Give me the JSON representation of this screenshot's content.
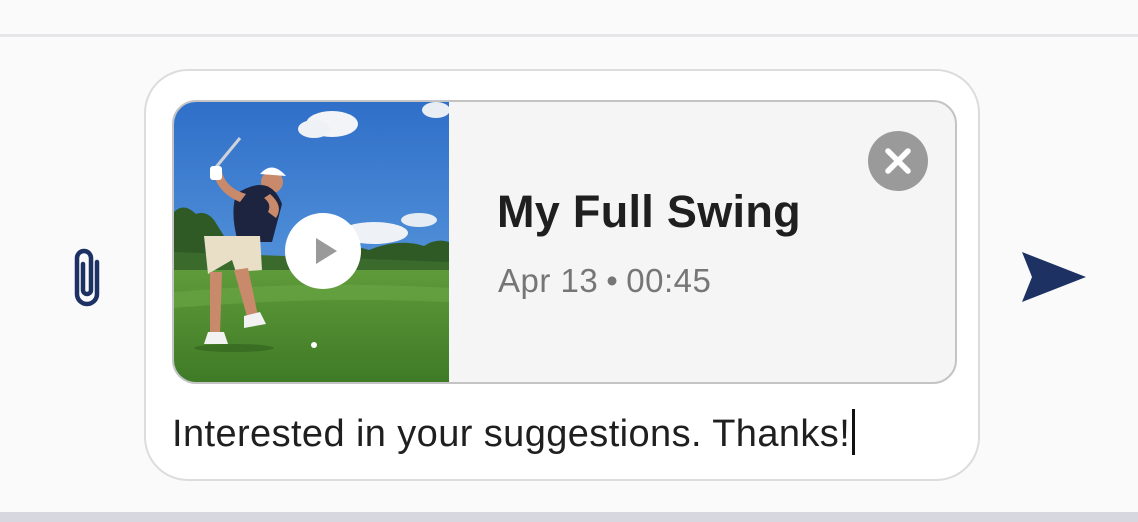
{
  "composer": {
    "attachment": {
      "title": "My Full Swing",
      "date": "Apr 13",
      "separator": "•",
      "duration": "00:45",
      "thumbnail_subject": "golfer mid-swing on a fairway",
      "icons": {
        "play": "play-icon",
        "remove": "close-icon"
      }
    },
    "message_text": "Interested in your suggestions. Thanks!",
    "icons": {
      "attach": "paperclip-icon",
      "send": "send-icon"
    }
  },
  "colors": {
    "accent": "#1d3263",
    "page_background": "#fafafa",
    "card_background": "#f5f5f5",
    "remove_button": "#9a9a9a"
  }
}
